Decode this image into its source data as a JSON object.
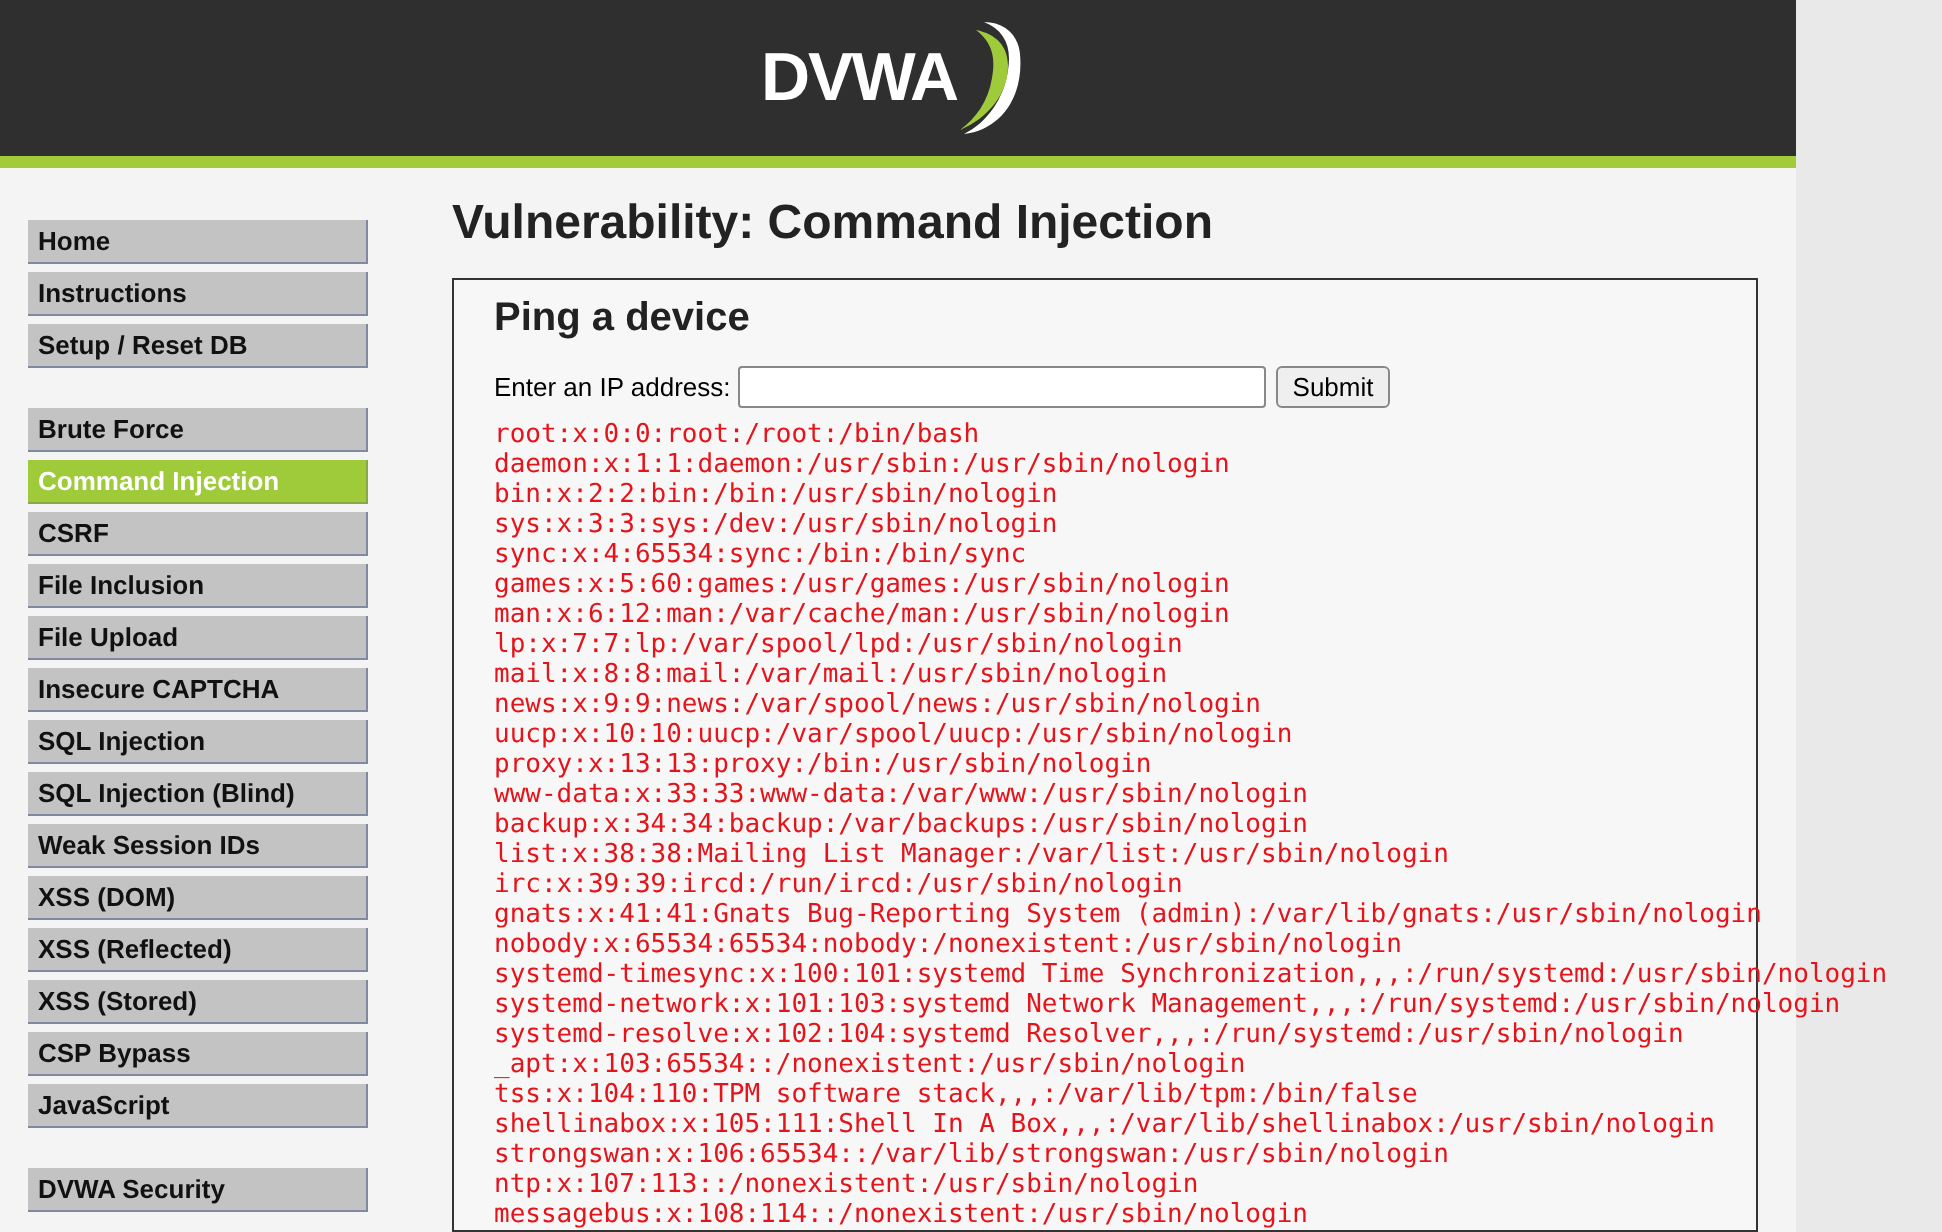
{
  "header": {
    "logo": "DVWA"
  },
  "sidebar": {
    "groups": [
      [
        {
          "label": "Home",
          "selected": false
        },
        {
          "label": "Instructions",
          "selected": false
        },
        {
          "label": "Setup / Reset DB",
          "selected": false
        }
      ],
      [
        {
          "label": "Brute Force",
          "selected": false
        },
        {
          "label": "Command Injection",
          "selected": true
        },
        {
          "label": "CSRF",
          "selected": false
        },
        {
          "label": "File Inclusion",
          "selected": false
        },
        {
          "label": "File Upload",
          "selected": false
        },
        {
          "label": "Insecure CAPTCHA",
          "selected": false
        },
        {
          "label": "SQL Injection",
          "selected": false
        },
        {
          "label": "SQL Injection (Blind)",
          "selected": false
        },
        {
          "label": "Weak Session IDs",
          "selected": false
        },
        {
          "label": "XSS (DOM)",
          "selected": false
        },
        {
          "label": "XSS (Reflected)",
          "selected": false
        },
        {
          "label": "XSS (Stored)",
          "selected": false
        },
        {
          "label": "CSP Bypass",
          "selected": false
        },
        {
          "label": "JavaScript",
          "selected": false
        }
      ],
      [
        {
          "label": "DVWA Security",
          "selected": false
        }
      ]
    ]
  },
  "page_title": "Vulnerability: Command Injection",
  "panel": {
    "title": "Ping a device",
    "field_label": "Enter an IP address:",
    "submit": "Submit",
    "output": [
      "root:x:0:0:root:/root:/bin/bash",
      "daemon:x:1:1:daemon:/usr/sbin:/usr/sbin/nologin",
      "bin:x:2:2:bin:/bin:/usr/sbin/nologin",
      "sys:x:3:3:sys:/dev:/usr/sbin/nologin",
      "sync:x:4:65534:sync:/bin:/bin/sync",
      "games:x:5:60:games:/usr/games:/usr/sbin/nologin",
      "man:x:6:12:man:/var/cache/man:/usr/sbin/nologin",
      "lp:x:7:7:lp:/var/spool/lpd:/usr/sbin/nologin",
      "mail:x:8:8:mail:/var/mail:/usr/sbin/nologin",
      "news:x:9:9:news:/var/spool/news:/usr/sbin/nologin",
      "uucp:x:10:10:uucp:/var/spool/uucp:/usr/sbin/nologin",
      "proxy:x:13:13:proxy:/bin:/usr/sbin/nologin",
      "www-data:x:33:33:www-data:/var/www:/usr/sbin/nologin",
      "backup:x:34:34:backup:/var/backups:/usr/sbin/nologin",
      "list:x:38:38:Mailing List Manager:/var/list:/usr/sbin/nologin",
      "irc:x:39:39:ircd:/run/ircd:/usr/sbin/nologin",
      "gnats:x:41:41:Gnats Bug-Reporting System (admin):/var/lib/gnats:/usr/sbin/nologin",
      "nobody:x:65534:65534:nobody:/nonexistent:/usr/sbin/nologin",
      "systemd-timesync:x:100:101:systemd Time Synchronization,,,:/run/systemd:/usr/sbin/nologin",
      "systemd-network:x:101:103:systemd Network Management,,,:/run/systemd:/usr/sbin/nologin",
      "systemd-resolve:x:102:104:systemd Resolver,,,:/run/systemd:/usr/sbin/nologin",
      "_apt:x:103:65534::/nonexistent:/usr/sbin/nologin",
      "tss:x:104:110:TPM software stack,,,:/var/lib/tpm:/bin/false",
      "shellinabox:x:105:111:Shell In A Box,,,:/var/lib/shellinabox:/usr/sbin/nologin",
      "strongswan:x:106:65534::/var/lib/strongswan:/usr/sbin/nologin",
      "ntp:x:107:113::/nonexistent:/usr/sbin/nologin",
      "messagebus:x:108:114::/nonexistent:/usr/sbin/nologin"
    ]
  }
}
